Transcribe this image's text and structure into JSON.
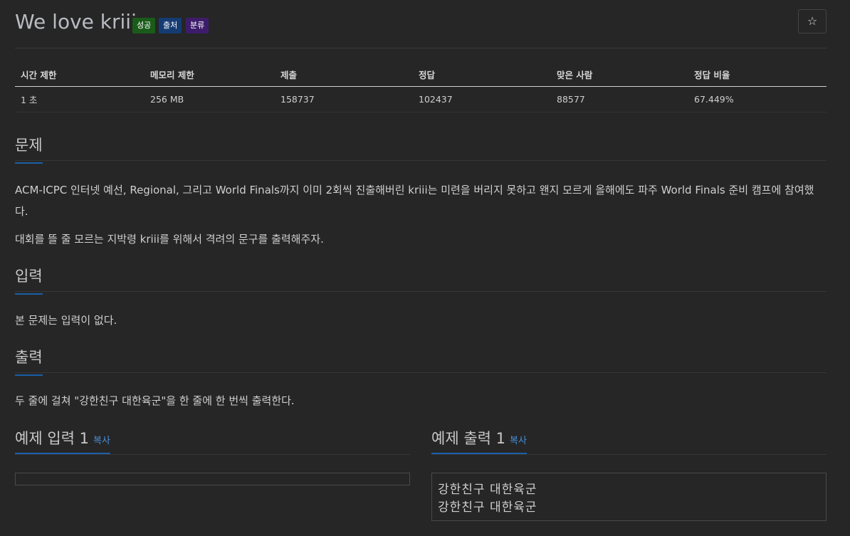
{
  "problem": {
    "title": "We love kriii",
    "labels": {
      "success": "성공",
      "source": "출처",
      "category": "분류"
    },
    "star_icon": "☆"
  },
  "info": {
    "headers": [
      "시간 제한",
      "메모리 제한",
      "제출",
      "정답",
      "맞은 사람",
      "정답 비율"
    ],
    "values": [
      "1 초",
      "256 MB",
      "158737",
      "102437",
      "88577",
      "67.449%"
    ]
  },
  "sections": {
    "problem_title": "문제",
    "problem_p1": "ACM-ICPC 인터넷 예선, Regional, 그리고 World Finals까지 이미 2회씩 진출해버린 kriii는 미련을 버리지 못하고 왠지 모르게 올해에도 파주 World Finals 준비 캠프에 참여했다.",
    "problem_p2": "대회를 뜰 줄 모르는 지박령 kriii를 위해서 격려의 문구를 출력해주자.",
    "input_title": "입력",
    "input_p": "본 문제는 입력이 없다.",
    "output_title": "출력",
    "output_p": "두 줄에 걸쳐 \"강한친구 대한육군\"을 한 줄에 한 번씩 출력한다."
  },
  "samples": {
    "input_title": "예제 입력 1",
    "input_copy": "복사",
    "input_value": "",
    "output_title": "예제 출력 1",
    "output_copy": "복사",
    "output_lines": [
      "강한친구 대한육군",
      "강한친구 대한육군"
    ]
  }
}
